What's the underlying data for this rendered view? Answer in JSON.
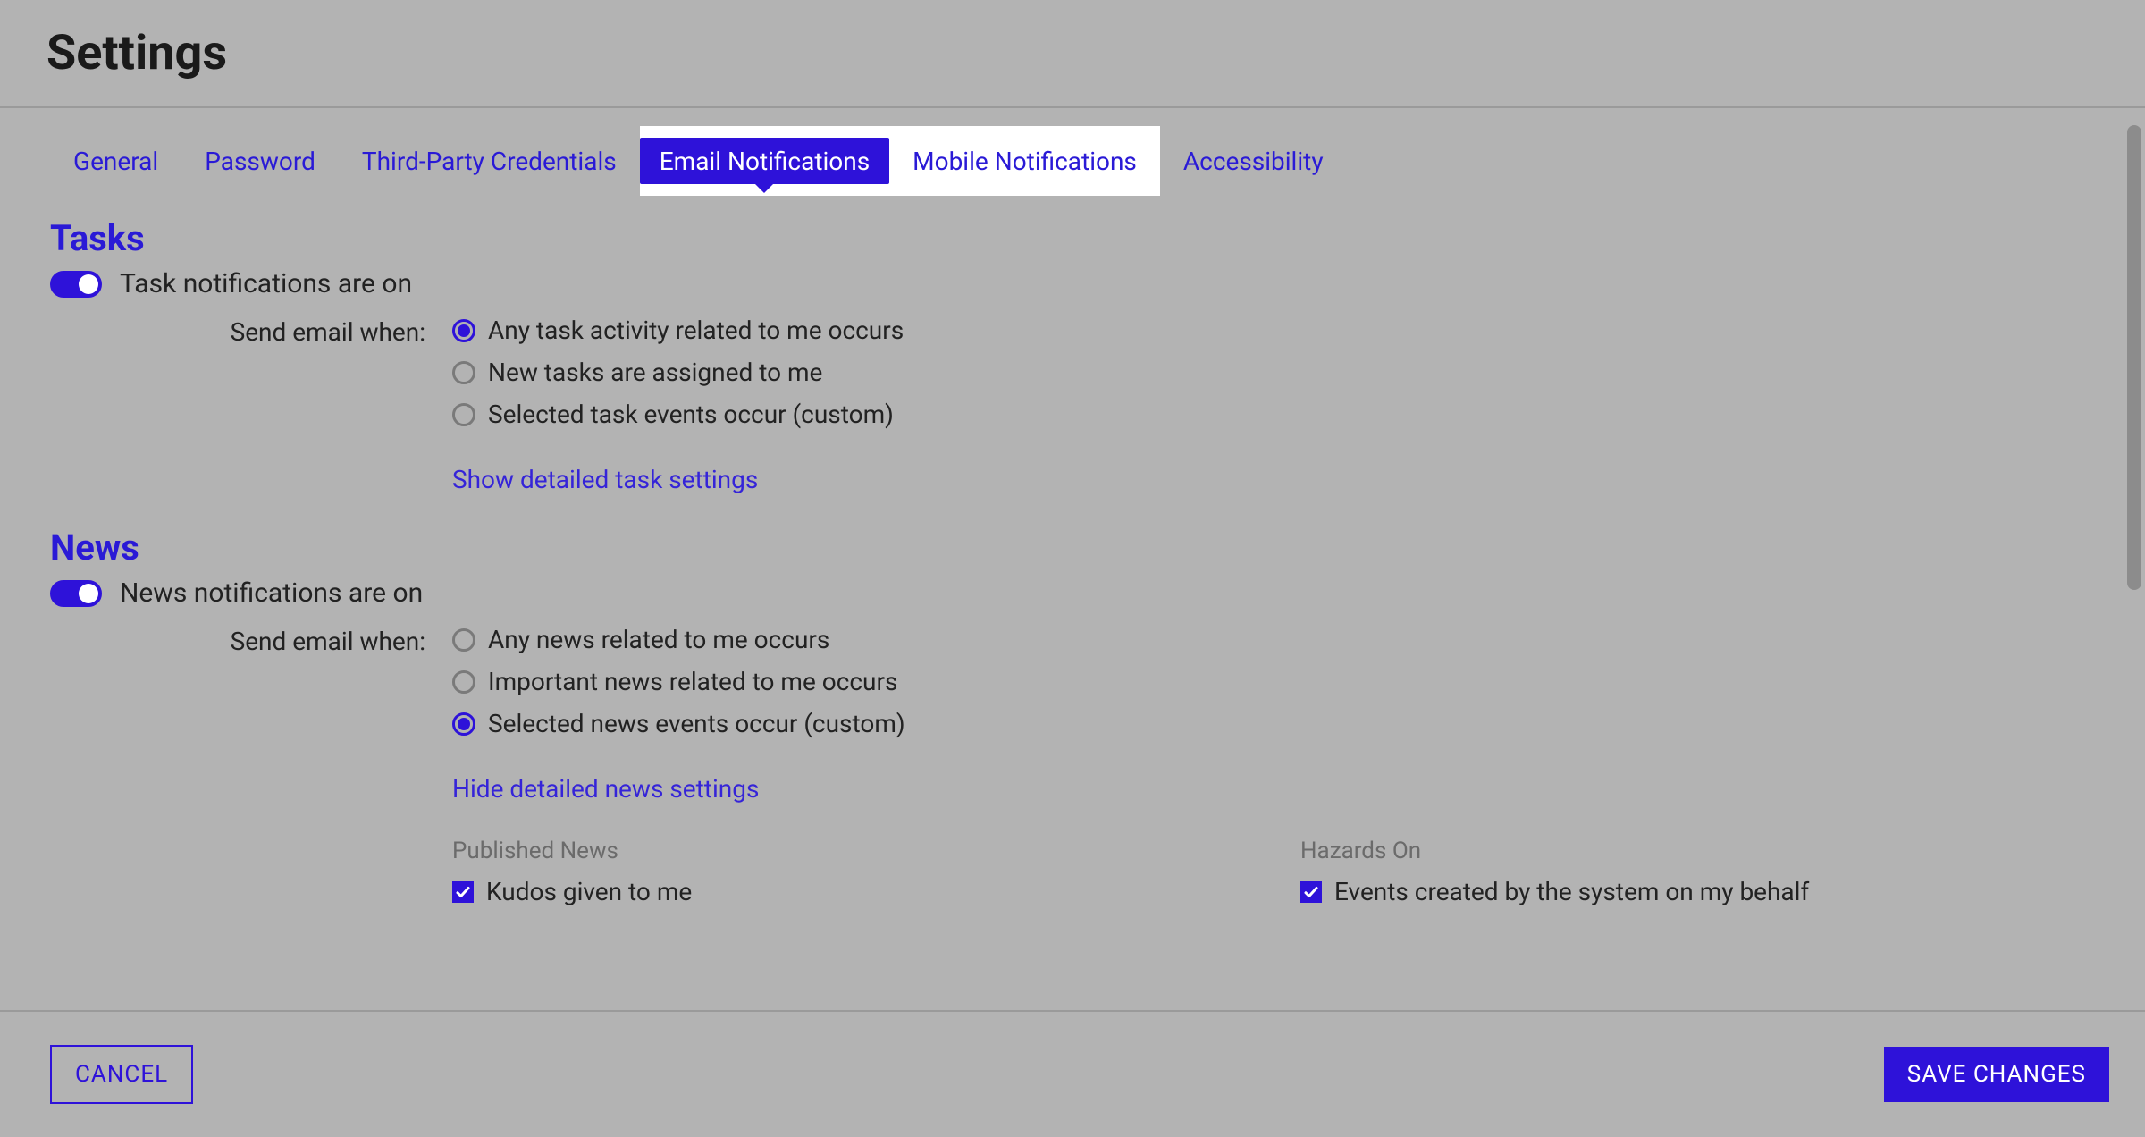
{
  "header": {
    "title": "Settings"
  },
  "tabs": {
    "items": [
      {
        "label": "General"
      },
      {
        "label": "Password"
      },
      {
        "label": "Third-Party Credentials"
      },
      {
        "label": "Email Notifications"
      },
      {
        "label": "Mobile Notifications"
      },
      {
        "label": "Accessibility"
      }
    ],
    "active_index": 3,
    "highlight_start": 3,
    "highlight_end": 4
  },
  "sections": {
    "tasks": {
      "title": "Tasks",
      "toggle_label": "Task notifications are on",
      "toggle_on": true,
      "form_label": "Send email when:",
      "options": [
        {
          "label": "Any task activity related to me occurs",
          "selected": true
        },
        {
          "label": "New tasks are assigned to me",
          "selected": false
        },
        {
          "label": "Selected task events occur (custom)",
          "selected": false
        }
      ],
      "detail_link": "Show detailed task settings"
    },
    "news": {
      "title": "News",
      "toggle_label": "News notifications are on",
      "toggle_on": true,
      "form_label": "Send email when:",
      "options": [
        {
          "label": "Any news related to me occurs",
          "selected": false
        },
        {
          "label": "Important news related to me occurs",
          "selected": false
        },
        {
          "label": "Selected news events occur (custom)",
          "selected": true
        }
      ],
      "detail_link": "Hide detailed news settings",
      "detail": {
        "left_header": "Published News",
        "left_items": [
          {
            "label": "Kudos given to me",
            "checked": true
          }
        ],
        "right_header": "Hazards On",
        "right_items": [
          {
            "label": "Events created by the system on my behalf",
            "checked": true
          }
        ]
      }
    }
  },
  "footer": {
    "cancel": "CANCEL",
    "save": "SAVE CHANGES"
  }
}
